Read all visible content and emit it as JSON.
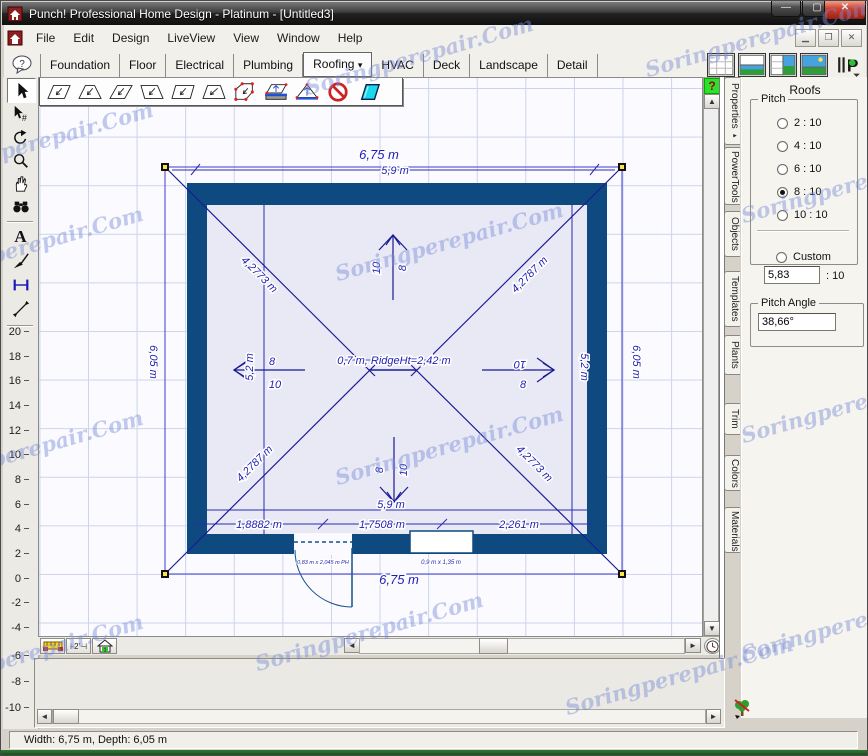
{
  "window": {
    "title": "Punch! Professional Home Design - Platinum - [Untitled3]",
    "status_text": "Width: 6,75 m, Depth: 6,05 m"
  },
  "menu": {
    "items": [
      "File",
      "Edit",
      "Design",
      "LiveView",
      "View",
      "Window",
      "Help"
    ]
  },
  "nav_tabs": {
    "items": [
      "Foundation",
      "Floor",
      "Electrical",
      "Plumbing",
      "Roofing",
      "HVAC",
      "Deck",
      "Landscape",
      "Detail"
    ],
    "active": "Roofing",
    "dropdown_marker": "▾"
  },
  "roofs_panel": {
    "title": "Roofs",
    "pitch_group": "Pitch",
    "pitch_options": [
      "2 : 10",
      "4 : 10",
      "6 : 10",
      "8 : 10",
      "10 : 10"
    ],
    "selected_pitch": "8 : 10",
    "custom_label": "Custom",
    "custom_value": "5,83",
    "custom_suffix": ": 10",
    "angle_group": "Pitch Angle",
    "angle_value": "38,66°",
    "side_tab_marker": "▸"
  },
  "side_tabs": [
    "Properties",
    "PowerTools",
    "Objects",
    "Templates",
    "Plants",
    "Trim",
    "Colors",
    "Materials"
  ],
  "ruler": [
    "20",
    "18",
    "16",
    "14",
    "12",
    "10",
    "8",
    "6",
    "4",
    "2",
    "0",
    "-2",
    "-4",
    "-6",
    "-8",
    "-10"
  ],
  "drawing": {
    "dim_top_overall": "6,75 m",
    "dim_top_wall": "5,9 m",
    "dim_left_overall": "6,05 m",
    "dim_right_overall": "6,05 m",
    "dim_left_wall": "5,2 m",
    "dim_right_wall": "5,2 m",
    "hip_tl": "4,2773 m",
    "hip_tr": "4,2787 m",
    "hip_bl": "4,2787 m",
    "hip_br": "4,2773 m",
    "ridge_note": "0,7 m, RidgeHt=2,42 m",
    "dim_bottom_wall": "5,9 m",
    "dim_seg_left": "1,8882 m",
    "dim_seg_mid": "1,7508 m",
    "dim_seg_right": "2,261 m",
    "dim_bottom_overall": "6,75 m",
    "door_label": "0,83 m x 2,045 m PH",
    "window_label": "0,9 m x 1,35 m",
    "slope": {
      "eight": "8",
      "ten": "10"
    }
  },
  "icons": {
    "text_tool_glyph": "A",
    "dim_preset_label": "2'",
    "house_level": "1",
    "help_glyph": "?"
  },
  "watermark": {
    "text": "Soringperepair.Com"
  }
}
